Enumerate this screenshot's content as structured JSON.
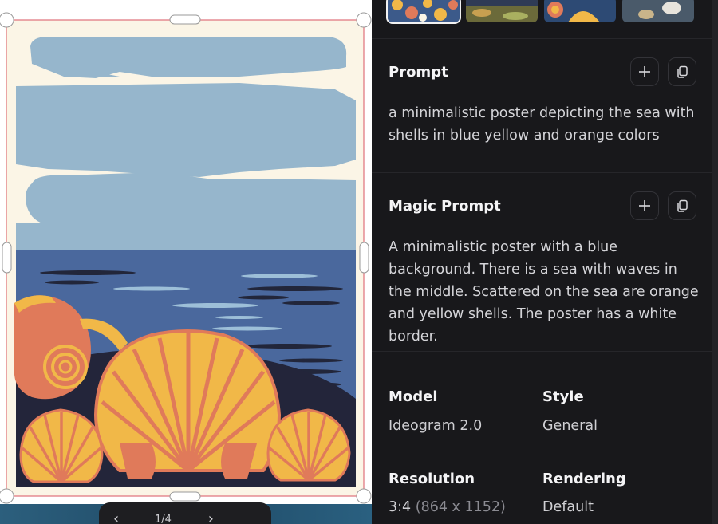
{
  "canvas": {
    "pager": {
      "prev": "‹",
      "counter": "1/4",
      "next": "›"
    }
  },
  "panel": {
    "prompt": {
      "title": "Prompt",
      "text": "a minimalistic poster depicting the sea with shells in blue yellow and orange colors"
    },
    "magic_prompt": {
      "title": "Magic Prompt",
      "text": "A minimalistic poster with a blue background. There is a sea with waves in the middle. Scattered on the sea are orange and yellow shells. The poster has a white border."
    },
    "details": {
      "model_label": "Model",
      "model_value": "Ideogram 2.0",
      "style_label": "Style",
      "style_value": "General",
      "resolution_label": "Resolution",
      "resolution_ratio": "3:4",
      "resolution_size": "(864 x 1152)",
      "rendering_label": "Rendering",
      "rendering_value": "Default"
    },
    "icons": {
      "add": "plus-icon",
      "copy": "copy-icon"
    }
  },
  "colors": {
    "panel_bg": "#18181b",
    "sky": "#96b6cc",
    "sea": "#4a689d",
    "shell_yellow": "#f1b848",
    "shell_orange": "#e07a5a",
    "selection": "#e0707a"
  }
}
